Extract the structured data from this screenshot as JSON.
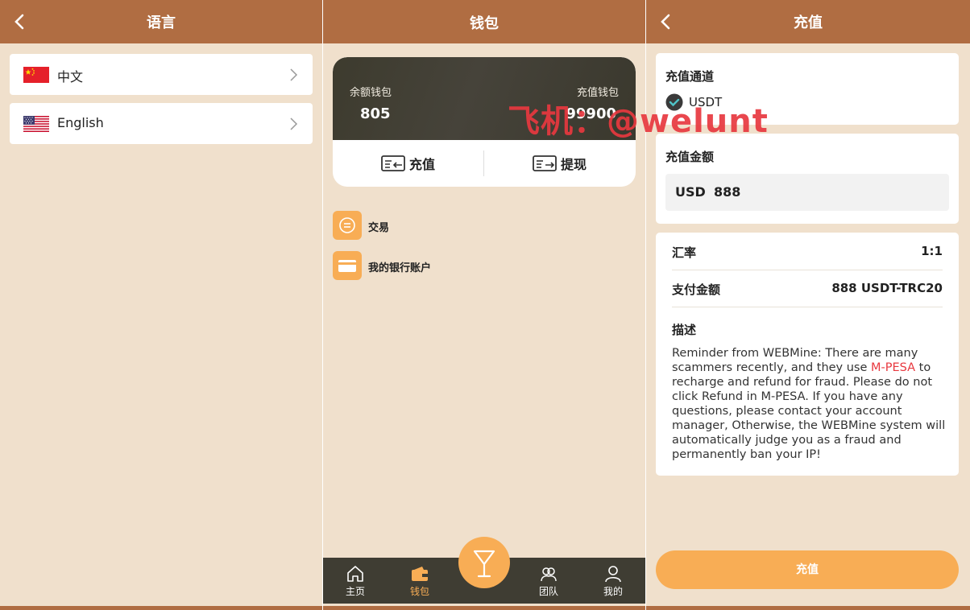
{
  "language_screen": {
    "title": "语言",
    "options": [
      {
        "label": "中文",
        "flag": "china-flag-icon"
      },
      {
        "label": "English",
        "flag": "usa-flag-icon"
      }
    ]
  },
  "wallet_screen": {
    "title": "钱包",
    "balance_wallet": {
      "label": "余额钱包",
      "value": "805"
    },
    "recharge_wallet": {
      "label": "充值钱包",
      "value": "99900"
    },
    "actions": {
      "recharge": "充值",
      "withdraw": "提现"
    },
    "menu": [
      {
        "label": "交易",
        "icon": "transaction-icon"
      },
      {
        "label": "我的银行账户",
        "icon": "bank-card-icon"
      }
    ],
    "nav": {
      "home": "主页",
      "wallet": "钱包",
      "team": "团队",
      "mine": "我的"
    },
    "watermark": "飞机：@welunt"
  },
  "recharge_screen": {
    "title": "充值",
    "channel": {
      "label": "充值通道",
      "option": "USDT"
    },
    "amount": {
      "label": "充值金额",
      "currency": "USD",
      "value": "888"
    },
    "rate": {
      "label": "汇率",
      "value": "1:1"
    },
    "pay_amount": {
      "label": "支付金额",
      "value": "888 USDT-TRC20"
    },
    "description": {
      "label": "描述",
      "text_before": "Reminder from WEBMine: There are many scammers recently, and they use ",
      "highlight": "M-PESA",
      "text_after": " to recharge and refund for fraud. Please do not click Refund in M-PESA. If you have any questions, please contact your account manager, Otherwise, the WEBMine system will automatically judge you as a fraud and permanently ban your IP!"
    },
    "submit": "充值"
  },
  "colors": {
    "header": "#b06d42",
    "background": "#f0e0cc",
    "accent": "#f8ad55",
    "card_dark": "#3f3d33",
    "highlight_red": "#e8383f"
  }
}
